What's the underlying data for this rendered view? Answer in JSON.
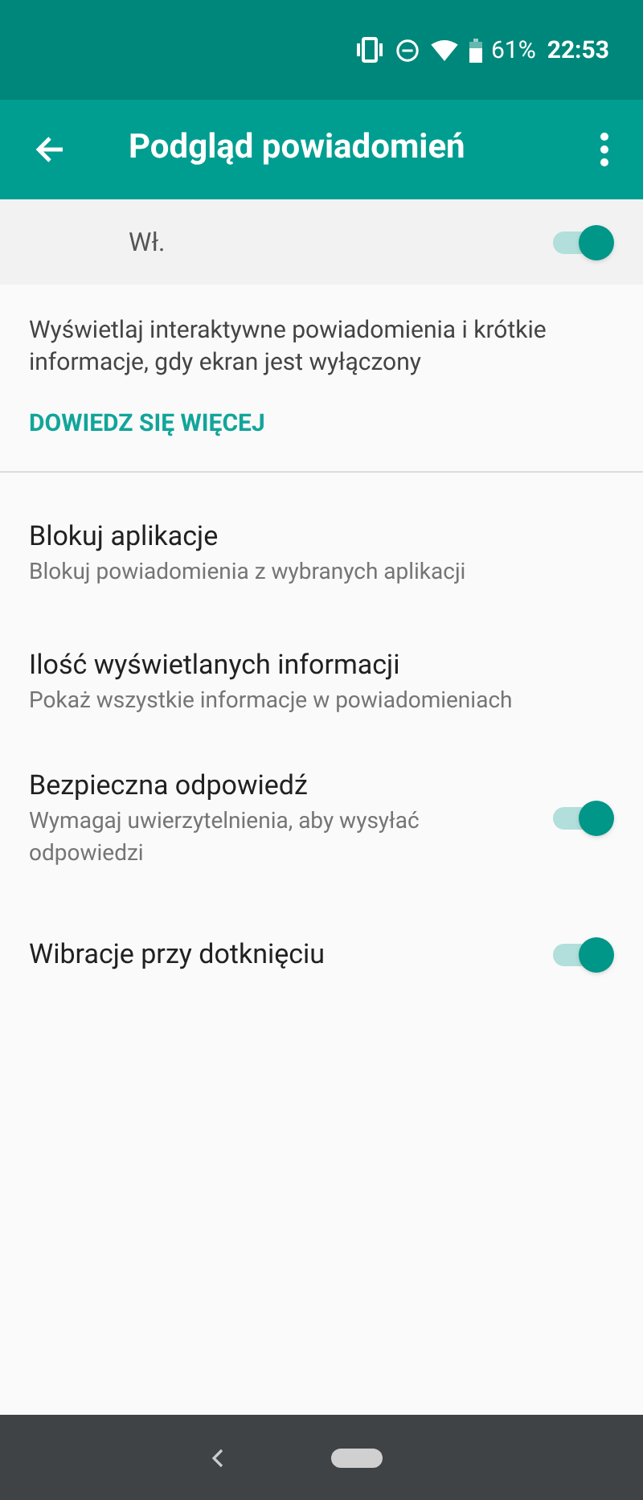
{
  "status_bar": {
    "battery": "61%",
    "time": "22:53"
  },
  "app_bar": {
    "title": "Podgląd powiadomień"
  },
  "master_switch": {
    "label": "Wł.",
    "on": true
  },
  "description": "Wyświetlaj interaktywne powiadomienia i krótkie informacje, gdy ekran jest wyłączony",
  "learn_more": "DOWIEDZ SIĘ WIĘCEJ",
  "settings": [
    {
      "kind": "link",
      "title": "Blokuj aplikacje",
      "summary": "Blokuj powiadomienia z wybranych aplikacji"
    },
    {
      "kind": "link",
      "title": "Ilość wyświetlanych informacji",
      "summary": "Pokaż wszystkie informacje w powiadomieniach"
    },
    {
      "kind": "switch",
      "title": "Bezpieczna odpowiedź",
      "summary": "Wymagaj uwierzytelnienia, aby wysyłać odpowiedzi",
      "on": true
    },
    {
      "kind": "switch",
      "title": "Wibracje przy dotknięciu",
      "on": true
    }
  ]
}
